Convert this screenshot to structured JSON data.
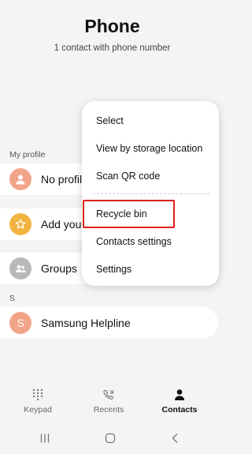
{
  "header": {
    "title": "Phone",
    "subtitle": "1 contact with phone number"
  },
  "sections": {
    "my_profile_label": "My profile",
    "s_label": "S"
  },
  "list": {
    "profile_label": "No profile",
    "add_label": "Add your",
    "groups_label": "Groups",
    "contact_initial": "S",
    "contact_name": "Samsung Helpline"
  },
  "menu": {
    "items": [
      "Select",
      "View by storage location",
      "Scan QR code",
      "Recycle bin",
      "Contacts settings",
      "Settings"
    ],
    "highlighted_item": "Recycle bin",
    "highlight_color": "#e0201b"
  },
  "bottom_nav": {
    "keypad": "Keypad",
    "recents": "Recents",
    "contacts": "Contacts",
    "active": "Contacts"
  },
  "icons": {
    "profile": "person-icon",
    "add": "star-icon",
    "groups": "group-icon",
    "keypad": "keypad-icon",
    "recents": "recents-icon",
    "contacts": "person-icon",
    "system": [
      "recent-apps-icon",
      "home-icon",
      "back-icon"
    ]
  },
  "colors": {
    "profile_avatar": "#f2a489",
    "add_avatar": "#f2b440",
    "groups_avatar": "#b9b9b9",
    "contact_avatar": "#f2a489"
  }
}
